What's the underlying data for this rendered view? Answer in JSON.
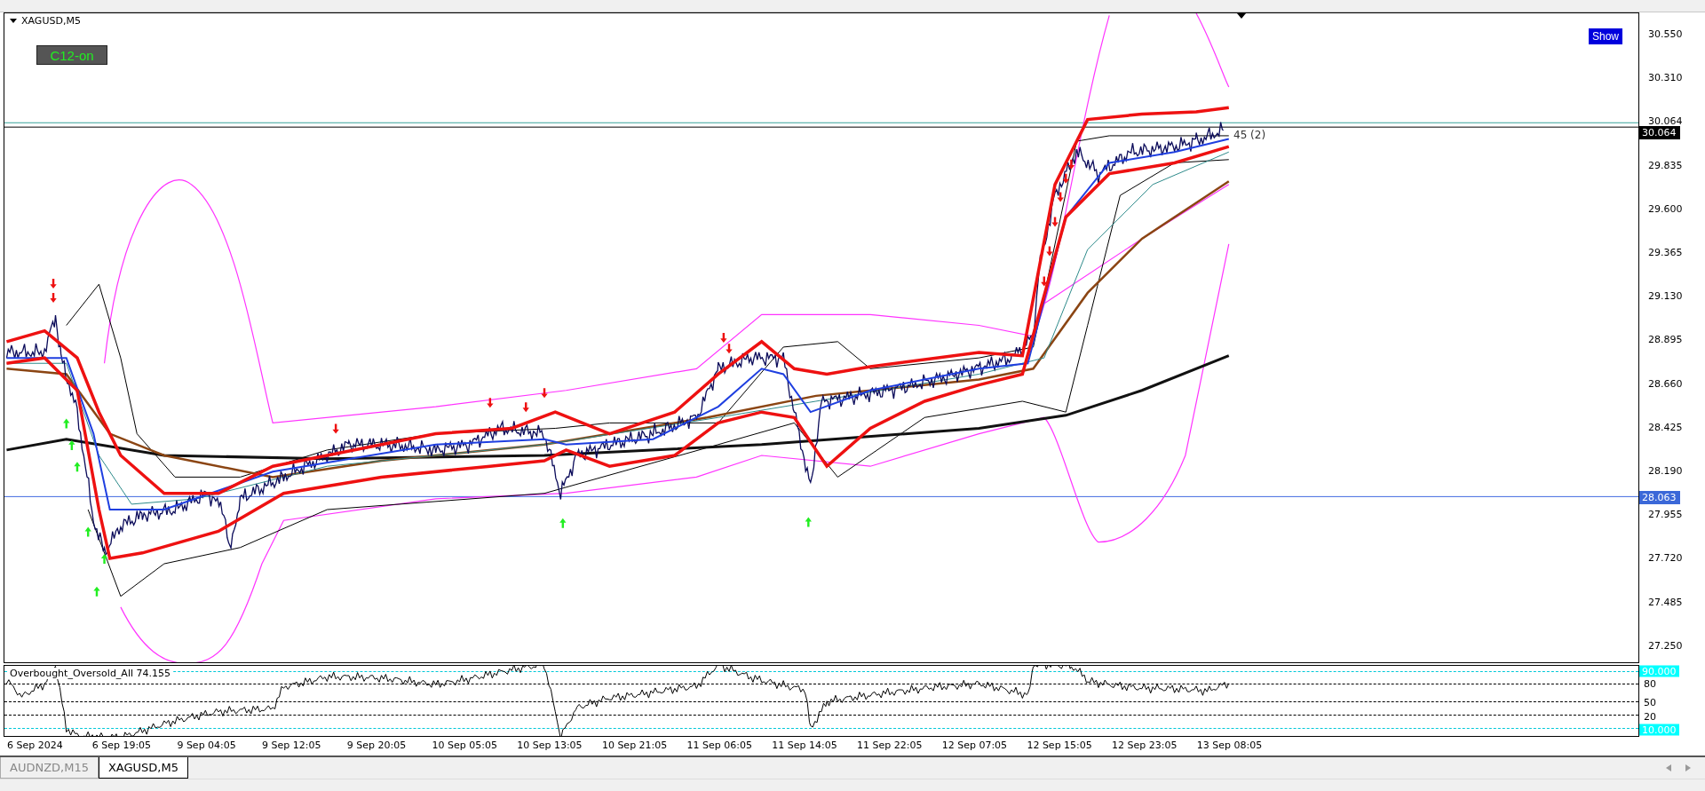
{
  "chart": {
    "title": "XAGUSD,M5",
    "c12_button": "C12-on",
    "show_button": "Show",
    "trade_label": "45 (2)",
    "price_axis": [
      "30.550",
      "30.310",
      "30.064",
      "29.835",
      "29.600",
      "29.365",
      "29.130",
      "28.895",
      "28.660",
      "28.425",
      "28.190",
      "27.955",
      "27.720",
      "27.485",
      "27.250"
    ],
    "price_labels": [
      {
        "text": "30.064",
        "kind": "bid"
      },
      {
        "text": "28.063",
        "kind": "line"
      }
    ]
  },
  "indicator": {
    "title": "Overbought_Oversold_All 74.155",
    "levels": [
      {
        "text": "90.000",
        "kind": "highlight"
      },
      {
        "text": "80",
        "kind": "plain"
      },
      {
        "text": "50",
        "kind": "plain"
      },
      {
        "text": "20",
        "kind": "plain"
      },
      {
        "text": "10.000",
        "kind": "highlight"
      }
    ]
  },
  "time_axis": [
    "6 Sep 2024",
    "6 Sep 19:05",
    "9 Sep 04:05",
    "9 Sep 12:05",
    "9 Sep 20:05",
    "10 Sep 05:05",
    "10 Sep 13:05",
    "10 Sep 21:05",
    "11 Sep 06:05",
    "11 Sep 14:05",
    "11 Sep 22:05",
    "12 Sep 07:05",
    "12 Sep 15:05",
    "12 Sep 23:05",
    "13 Sep 08:05"
  ],
  "tabs": [
    {
      "label": "AUDNZD,M15",
      "selected": false
    },
    {
      "label": "XAGUSD,M5",
      "selected": true
    }
  ]
}
